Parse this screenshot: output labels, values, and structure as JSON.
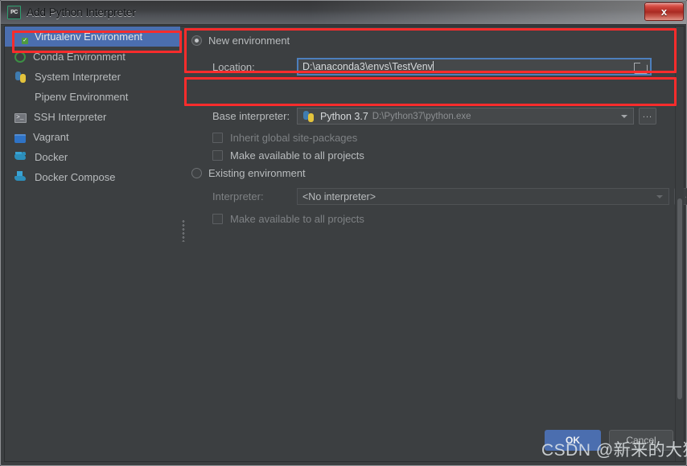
{
  "window": {
    "title": "Add Python Interpreter",
    "app_icon": "pycharm-icon",
    "close_label": "x"
  },
  "sidebar": {
    "items": [
      {
        "label": "Virtualenv Environment",
        "icon": "virtualenv-python-icon",
        "selected": true
      },
      {
        "label": "Conda Environment",
        "icon": "conda-circle-icon",
        "selected": false
      },
      {
        "label": "System Interpreter",
        "icon": "python-icon",
        "selected": false
      },
      {
        "label": "Pipenv Environment",
        "icon": "pipenv-icon",
        "selected": false
      },
      {
        "label": "SSH Interpreter",
        "icon": "terminal-icon",
        "selected": false
      },
      {
        "label": "Vagrant",
        "icon": "vagrant-box-icon",
        "selected": false
      },
      {
        "label": "Docker",
        "icon": "docker-whale-icon",
        "selected": false
      },
      {
        "label": "Docker Compose",
        "icon": "docker-compose-icon",
        "selected": false
      }
    ]
  },
  "panel": {
    "new_environment": {
      "radio_label": "New environment",
      "selected": true,
      "location_label": "Location:",
      "location_value": "D:\\anaconda3\\envs\\TestVenv",
      "browse_icon": "folder-icon",
      "base_interpreter_label": "Base interpreter:",
      "base_interpreter_value": "Python 3.7",
      "base_interpreter_path": "D:\\Python37\\python.exe",
      "base_interpreter_icon": "python-icon",
      "more_button_label": "...",
      "checkbox_inherit_label": "Inherit global site-packages",
      "checkbox_inherit_checked": false,
      "checkbox_makeall_label": "Make available to all projects",
      "checkbox_makeall_checked": false
    },
    "existing_environment": {
      "radio_label": "Existing environment",
      "selected": false,
      "interpreter_label": "Interpreter:",
      "interpreter_value": "<No interpreter>",
      "more_button_label": "...",
      "checkbox_makeall_label": "Make available to all projects",
      "checkbox_makeall_checked": false
    }
  },
  "footer": {
    "ok_label": "OK",
    "cancel_label": "Cancel"
  },
  "watermark": {
    "text": "CSDN @新来的大狮"
  },
  "colors": {
    "accent_blue": "#4b6eaf",
    "annotation_red": "#fb2c2c",
    "field_focus_blue": "#4d7fbd",
    "dialog_bg": "#3c3f41",
    "close_red": "#a92a22"
  }
}
